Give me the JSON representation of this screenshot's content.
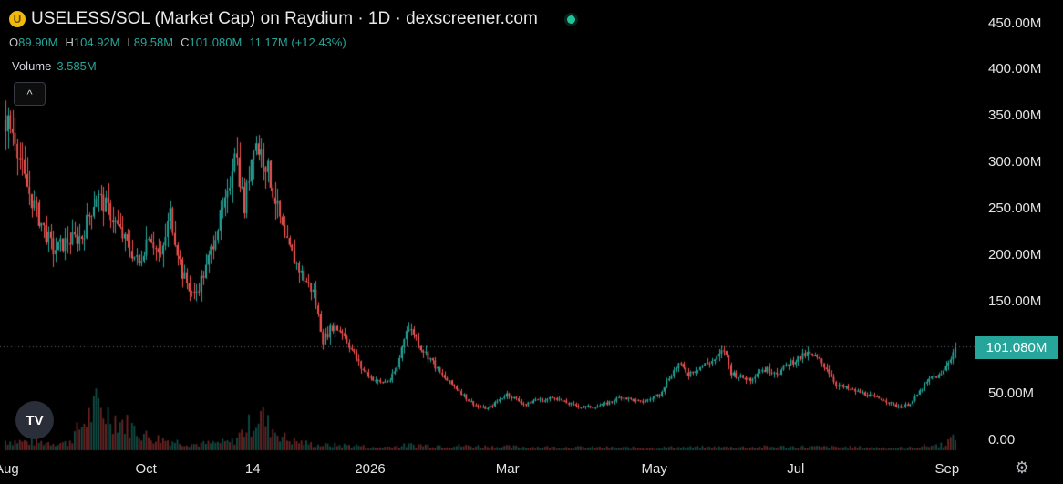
{
  "header": {
    "coin_letter": "U",
    "title": "USELESS/SOL (Market Cap) on Raydium · 1D · dexscreener.com",
    "ohlc": [
      {
        "k": "O",
        "v": "89.90M"
      },
      {
        "k": "H",
        "v": "104.92M"
      },
      {
        "k": "L",
        "v": "89.58M"
      },
      {
        "k": "C",
        "v": "101.080M"
      },
      {
        "k": "",
        "v": "11.17M (+12.43%)"
      }
    ],
    "volume_label": "Volume",
    "volume_value": "3.585M",
    "collapse_glyph": "^",
    "tv_logo": "TV"
  },
  "price_tag": "101.080M",
  "colors": {
    "up": "#26a69a",
    "down": "#ef5350",
    "background": "#000000",
    "tag": "#26a69a"
  },
  "chart_data": {
    "type": "candlestick",
    "y_ticks": [
      "450.00M",
      "400.00M",
      "350.00M",
      "300.00M",
      "250.00M",
      "200.00M",
      "150.00M",
      "50.00M",
      "0.00"
    ],
    "y_tick_values": [
      450,
      400,
      350,
      300,
      250,
      200,
      150,
      50,
      0
    ],
    "x_ticks": [
      "Aug",
      "Oct",
      "14",
      "2026",
      "Mar",
      "May",
      "Jul",
      "Sep"
    ],
    "x_tick_days": [
      0,
      59,
      105,
      151,
      210,
      271,
      332,
      394
    ],
    "ylim": [
      0,
      450
    ],
    "current_price": 101.08,
    "unit": "M",
    "last_day": 398,
    "close_anchors": [
      [
        0,
        345
      ],
      [
        4,
        330
      ],
      [
        8,
        280
      ],
      [
        14,
        240
      ],
      [
        20,
        205
      ],
      [
        26,
        215
      ],
      [
        32,
        220
      ],
      [
        38,
        265
      ],
      [
        44,
        245
      ],
      [
        50,
        215
      ],
      [
        56,
        190
      ],
      [
        60,
        225
      ],
      [
        65,
        195
      ],
      [
        69,
        245
      ],
      [
        74,
        180
      ],
      [
        79,
        155
      ],
      [
        84,
        185
      ],
      [
        88,
        225
      ],
      [
        93,
        260
      ],
      [
        96,
        320
      ],
      [
        100,
        250
      ],
      [
        104,
        325
      ],
      [
        109,
        300
      ],
      [
        113,
        260
      ],
      [
        117,
        215
      ],
      [
        121,
        195
      ],
      [
        125,
        175
      ],
      [
        129,
        160
      ],
      [
        133,
        108
      ],
      [
        137,
        123
      ],
      [
        141,
        118
      ],
      [
        145,
        98
      ],
      [
        149,
        78
      ],
      [
        153,
        68
      ],
      [
        157,
        62
      ],
      [
        161,
        65
      ],
      [
        164,
        78
      ],
      [
        168,
        122
      ],
      [
        171,
        116
      ],
      [
        174,
        100
      ],
      [
        178,
        88
      ],
      [
        182,
        72
      ],
      [
        186,
        62
      ],
      [
        190,
        54
      ],
      [
        194,
        43
      ],
      [
        198,
        36
      ],
      [
        202,
        34
      ],
      [
        206,
        42
      ],
      [
        210,
        50
      ],
      [
        214,
        44
      ],
      [
        218,
        38
      ],
      [
        222,
        44
      ],
      [
        226,
        43
      ],
      [
        230,
        47
      ],
      [
        234,
        41
      ],
      [
        238,
        38
      ],
      [
        242,
        36
      ],
      [
        246,
        36
      ],
      [
        250,
        38
      ],
      [
        254,
        42
      ],
      [
        258,
        47
      ],
      [
        262,
        44
      ],
      [
        266,
        41
      ],
      [
        270,
        44
      ],
      [
        274,
        50
      ],
      [
        278,
        68
      ],
      [
        282,
        82
      ],
      [
        286,
        72
      ],
      [
        290,
        78
      ],
      [
        294,
        83
      ],
      [
        298,
        88
      ],
      [
        301,
        98
      ],
      [
        304,
        73
      ],
      [
        308,
        68
      ],
      [
        312,
        66
      ],
      [
        316,
        76
      ],
      [
        320,
        76
      ],
      [
        324,
        73
      ],
      [
        328,
        83
      ],
      [
        332,
        88
      ],
      [
        336,
        93
      ],
      [
        340,
        88
      ],
      [
        344,
        78
      ],
      [
        348,
        60
      ],
      [
        352,
        56
      ],
      [
        356,
        53
      ],
      [
        360,
        50
      ],
      [
        364,
        46
      ],
      [
        368,
        44
      ],
      [
        372,
        38
      ],
      [
        376,
        36
      ],
      [
        380,
        42
      ],
      [
        384,
        56
      ],
      [
        388,
        68
      ],
      [
        392,
        70
      ],
      [
        396,
        90
      ],
      [
        398,
        101.08
      ]
    ],
    "volume_unit": "M",
    "volume_peaks": [
      [
        0,
        16
      ],
      [
        10,
        14
      ],
      [
        26,
        12
      ],
      [
        38,
        72
      ],
      [
        60,
        22
      ],
      [
        79,
        10
      ],
      [
        95,
        14
      ],
      [
        107,
        60
      ],
      [
        110,
        42
      ],
      [
        118,
        18
      ],
      [
        123,
        14
      ],
      [
        130,
        9
      ],
      [
        148,
        8
      ],
      [
        153,
        4
      ],
      [
        171,
        9
      ],
      [
        206,
        6
      ],
      [
        271,
        4
      ],
      [
        278,
        5
      ],
      [
        300,
        5
      ],
      [
        332,
        6
      ],
      [
        378,
        4
      ],
      [
        393,
        10
      ],
      [
        396,
        18
      ]
    ]
  }
}
